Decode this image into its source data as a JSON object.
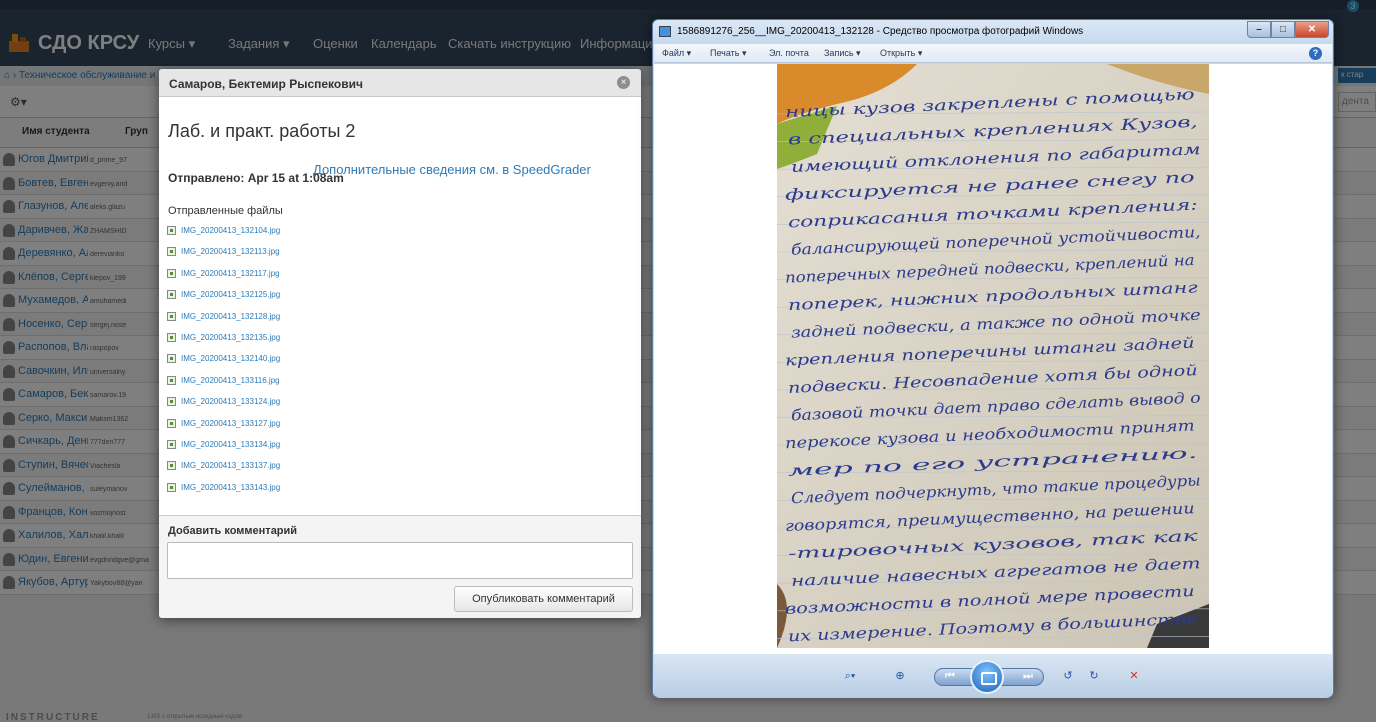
{
  "lms": {
    "logo": "СДО КРСУ",
    "nav": [
      {
        "label": "Курсы ▾"
      },
      {
        "label": "Задания ▾"
      },
      {
        "label": "Оценки"
      },
      {
        "label": "Календарь"
      },
      {
        "label": "Скачать инструкцию"
      },
      {
        "label": "Информаци"
      }
    ],
    "breadcrumb": "Техническое обслуживание и",
    "badge": "3",
    "crumb_right": "к стар",
    "search_stub": "дента",
    "gear_label": "⚙▾",
    "columns": {
      "name": "Имя студента",
      "group": "Груп"
    },
    "students": [
      {
        "name": "Югов Дмитрий Ал",
        "email": "d_prime_97"
      },
      {
        "name": "Бовтев, Евгений А",
        "email": "evgeniy.and"
      },
      {
        "name": "Глазунов, Алекса",
        "email": "aleks.glazu"
      },
      {
        "name": "Даривчев, Жаму",
        "email": "ZHAMSHID"
      },
      {
        "name": "Деревянко, Алекс",
        "email": "derevianko"
      },
      {
        "name": "Клёпов, Сергей Г",
        "email": "klepov_199"
      },
      {
        "name": "Мухамедов, Абду",
        "email": "amuhamedi"
      },
      {
        "name": "Носенко, Сергей",
        "email": "sergej.nose"
      },
      {
        "name": "Распопов, Влади",
        "email": "raspopov"
      },
      {
        "name": "Савочкин, Илья Е",
        "email": "universalny"
      },
      {
        "name": "Самаров, Бектем",
        "email": "samarov.19"
      },
      {
        "name": "Серко, Максим С",
        "email": "Maksm1362"
      },
      {
        "name": "Сичкарь, Денис А",
        "email": "777den777"
      },
      {
        "name": "Ступин, Вячеслав",
        "email": "Viachesla"
      },
      {
        "name": "Сулейманов, Ази",
        "email": "suleymanov"
      },
      {
        "name": "Францов, Констан",
        "email": "vozmojnost"
      },
      {
        "name": "Халилов, Халил",
        "email": "khalil.khalil"
      },
      {
        "name": "Юдин, Евгений С",
        "email": "evgdnndgve@gma"
      },
      {
        "name": "Якубов, Артур Ру",
        "email": "Yakybov88@yan"
      }
    ],
    "footer_brand": "INSTRUCTURE",
    "footer_text": "LMS с открытым исходным кодом"
  },
  "modal": {
    "title": "Самаров, Бектемир Рыспекович",
    "assignment": "Лаб. и практ. работы 2",
    "submitted": "Отправлено: Apr 15 at 1:08am",
    "speedgrader_link": "Дополнительные сведения см. в SpeedGrader",
    "files_heading": "Отправленные файлы",
    "files": [
      "IMG_20200413_132104.jpg",
      "IMG_20200413_132113.jpg",
      "IMG_20200413_132117.jpg",
      "IMG_20200413_132125.jpg",
      "IMG_20200413_132128.jpg",
      "IMG_20200413_132135.jpg",
      "IMG_20200413_132140.jpg",
      "IMG_20200413_133116.jpg",
      "IMG_20200413_133124.jpg",
      "IMG_20200413_133127.jpg",
      "IMG_20200413_133134.jpg",
      "IMG_20200413_133137.jpg",
      "IMG_20200413_133143.jpg"
    ],
    "comment_label": "Добавить комментарий",
    "comment_value": "",
    "post_button": "Опубликовать комментарий",
    "close_glyph": "×"
  },
  "viewer": {
    "title": "1586891276_256__IMG_20200413_132128 - Средство просмотра фотографий Windows",
    "menu": [
      "Файл ▾",
      "Печать ▾",
      "Эл. почта",
      "Запись ▾",
      "Открыть ▾"
    ],
    "help": "?",
    "handwriting": [
      "ницы кузов закреплены с помощью",
      "в специальных креплениях Кузов,",
      "имеющий отклонения по габаритам",
      "фиксируется не ранее снегу по",
      "соприкасания точками крепления:",
      "балансирующей поперечной устойчивости,",
      "поперечных передней подвески, креплений на",
      "поперек, нижних продольных штанг",
      "задней подвески, а также по одной точке",
      "крепления поперечины штанги задней",
      "подвески. Несовпадение хотя бы одной",
      "базовой точки дает право сделать вывод о",
      "перекосе кузова и необходимости принят",
      "мер по его устранению.",
      "Следует подчеркнуть, что такие процедуры",
      "говорятся, преимущественно, на решении",
      "-тировочных кузовов, так как",
      "наличие навесных агрегатов не дает",
      "возможности в полной мере провести",
      "их измерение. Поэтому в большинстве"
    ],
    "controls": {
      "zoom": "⌕▾",
      "fit": "⊕",
      "prev": "⏮",
      "next": "⏭",
      "rotate_ccw": "↺",
      "rotate_cw": "↻",
      "delete": "✕"
    }
  },
  "colors": {
    "header_bg": "#34495e",
    "link": "#2d7bb8",
    "ink": "#2b3a8c",
    "paper": "#dcd6c8"
  }
}
